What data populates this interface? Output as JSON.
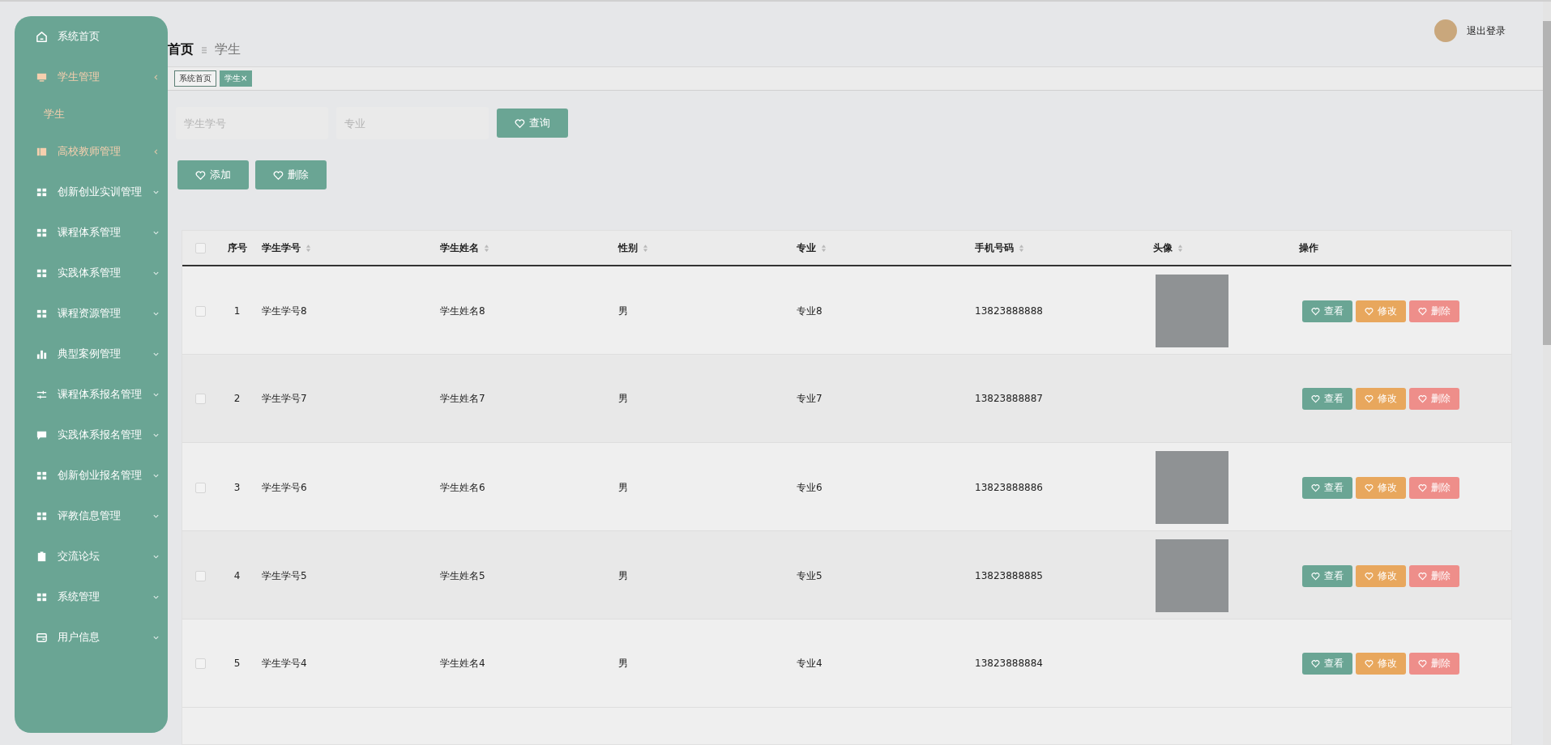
{
  "sidebar": {
    "items": [
      {
        "label": "系统首页",
        "kind": "link",
        "active": false
      },
      {
        "label": "学生管理",
        "kind": "menu",
        "active": true,
        "expanded": true,
        "children": [
          {
            "label": "学生",
            "selected": true
          }
        ]
      },
      {
        "label": "高校教师管理",
        "kind": "menu",
        "active": true,
        "expanded": true
      },
      {
        "label": "创新创业实训管理",
        "kind": "menu",
        "active": false,
        "expanded": false
      },
      {
        "label": "课程体系管理",
        "kind": "menu",
        "active": false,
        "expanded": false
      },
      {
        "label": "实践体系管理",
        "kind": "menu",
        "active": false,
        "expanded": false
      },
      {
        "label": "课程资源管理",
        "kind": "menu",
        "active": false,
        "expanded": false
      },
      {
        "label": "典型案例管理",
        "kind": "menu",
        "active": false,
        "expanded": false
      },
      {
        "label": "课程体系报名管理",
        "kind": "menu",
        "active": false,
        "expanded": false
      },
      {
        "label": "实践体系报名管理",
        "kind": "menu",
        "active": false,
        "expanded": false
      },
      {
        "label": "创新创业报名管理",
        "kind": "menu",
        "active": false,
        "expanded": false
      },
      {
        "label": "评教信息管理",
        "kind": "menu",
        "active": false,
        "expanded": false
      },
      {
        "label": "交流论坛",
        "kind": "menu",
        "active": false,
        "expanded": false
      },
      {
        "label": "系统管理",
        "kind": "menu",
        "active": false,
        "expanded": false
      },
      {
        "label": "用户信息",
        "kind": "menu",
        "active": false,
        "expanded": false
      }
    ]
  },
  "header": {
    "logout": "退出登录"
  },
  "breadcrumb": [
    "首页",
    "学生"
  ],
  "tags": [
    {
      "label": "系统首页",
      "selected": false
    },
    {
      "label": "学生",
      "selected": true,
      "close": "×"
    }
  ],
  "search": {
    "fields": [
      {
        "placeholder": "学生学号"
      },
      {
        "placeholder": "专业"
      }
    ],
    "button": "查询"
  },
  "actions": [
    "添加",
    "删除"
  ],
  "table": {
    "all_checked": false,
    "columns": [
      {
        "label": "序号",
        "sortable": false
      },
      {
        "label": "学生学号",
        "sortable": true
      },
      {
        "label": "学生姓名",
        "sortable": true
      },
      {
        "label": "性别",
        "sortable": true
      },
      {
        "label": "专业",
        "sortable": true
      },
      {
        "label": "手机号码",
        "sortable": true
      },
      {
        "label": "头像",
        "sortable": true
      },
      {
        "label": "操作",
        "sortable": false
      }
    ],
    "rows": [
      {
        "checked": false,
        "index": "1",
        "student_id": "学生学号8",
        "name": "学生姓名8",
        "gender": "男",
        "major": "专业8",
        "phone": "13823888888",
        "photo": true,
        "actions": [
          {
            "label": "查看",
            "kind": "view"
          },
          {
            "label": "修改",
            "kind": "edit"
          },
          {
            "label": "删除",
            "kind": "delete"
          }
        ]
      },
      {
        "checked": false,
        "index": "2",
        "student_id": "学生学号7",
        "name": "学生姓名7",
        "gender": "男",
        "major": "专业7",
        "phone": "13823888887",
        "photo": false,
        "actions": [
          {
            "label": "查看",
            "kind": "view"
          },
          {
            "label": "修改",
            "kind": "edit"
          },
          {
            "label": "删除",
            "kind": "delete"
          }
        ]
      },
      {
        "checked": false,
        "index": "3",
        "student_id": "学生学号6",
        "name": "学生姓名6",
        "gender": "男",
        "major": "专业6",
        "phone": "13823888886",
        "photo": true,
        "actions": [
          {
            "label": "查看",
            "kind": "view"
          },
          {
            "label": "修改",
            "kind": "edit"
          },
          {
            "label": "删除",
            "kind": "delete"
          }
        ]
      },
      {
        "checked": false,
        "index": "4",
        "student_id": "学生学号5",
        "name": "学生姓名5",
        "gender": "男",
        "major": "专业5",
        "phone": "13823888885",
        "photo": true,
        "actions": [
          {
            "label": "查看",
            "kind": "view"
          },
          {
            "label": "修改",
            "kind": "edit"
          },
          {
            "label": "删除",
            "kind": "delete"
          }
        ]
      },
      {
        "checked": false,
        "index": "5",
        "student_id": "学生学号4",
        "name": "学生姓名4",
        "gender": "男",
        "major": "专业4",
        "phone": "13823888884",
        "photo": false,
        "actions": [
          {
            "label": "查看",
            "kind": "view"
          },
          {
            "label": "修改",
            "kind": "edit"
          },
          {
            "label": "删除",
            "kind": "delete"
          }
        ]
      }
    ]
  }
}
